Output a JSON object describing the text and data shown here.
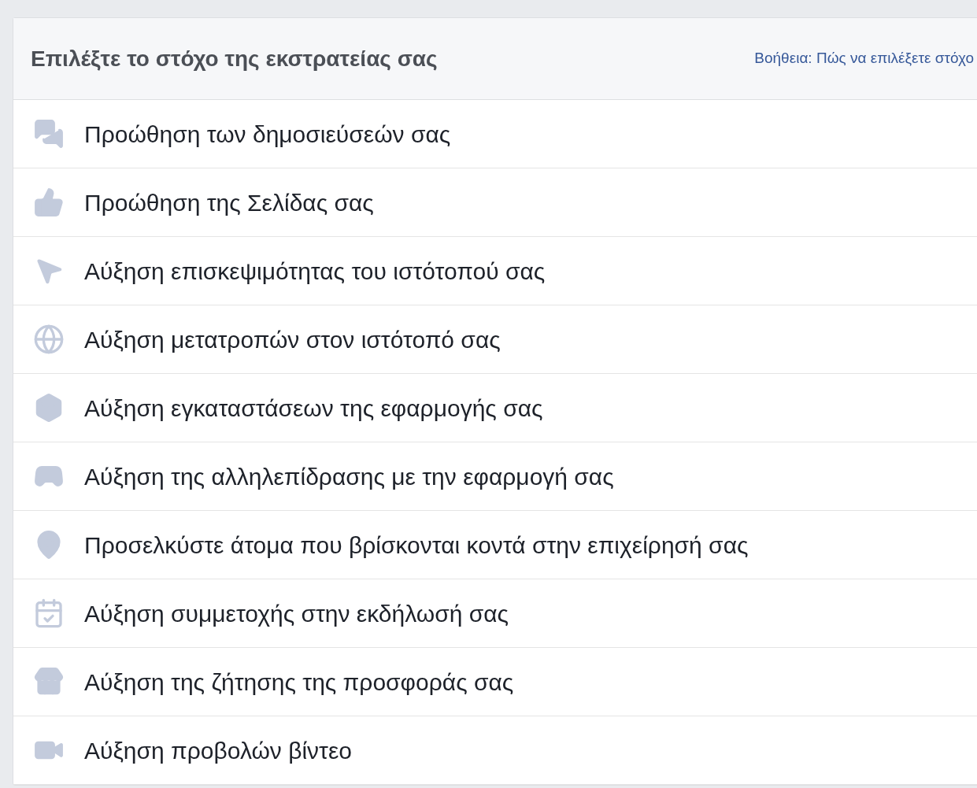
{
  "header": {
    "title": "Επιλέξτε το στόχο της εκστρατείας σας",
    "help_link": "Βοήθεια: Πώς να επιλέξετε στόχο"
  },
  "objectives": [
    {
      "kind": "posts",
      "label": "Προώθηση των δημοσιεύσεών σας"
    },
    {
      "kind": "page",
      "label": "Προώθηση της Σελίδας σας"
    },
    {
      "kind": "clicks",
      "label": "Αύξηση επισκεψιμότητας του ιστότοπού σας"
    },
    {
      "kind": "conversions",
      "label": "Αύξηση μετατροπών στον ιστότοπό σας"
    },
    {
      "kind": "installs",
      "label": "Αύξηση εγκαταστάσεων της εφαρμογής σας"
    },
    {
      "kind": "engagement",
      "label": "Αύξηση της αλληλεπίδρασης με την εφαρμογή σας"
    },
    {
      "kind": "local",
      "label": "Προσελκύστε άτομα που βρίσκονται κοντά στην επιχείρησή σας"
    },
    {
      "kind": "event",
      "label": "Αύξηση συμμετοχής στην εκδήλωσή σας"
    },
    {
      "kind": "offer",
      "label": "Αύξηση της ζήτησης της προσφοράς σας"
    },
    {
      "kind": "video",
      "label": "Αύξηση προβολών βίντεο"
    }
  ]
}
